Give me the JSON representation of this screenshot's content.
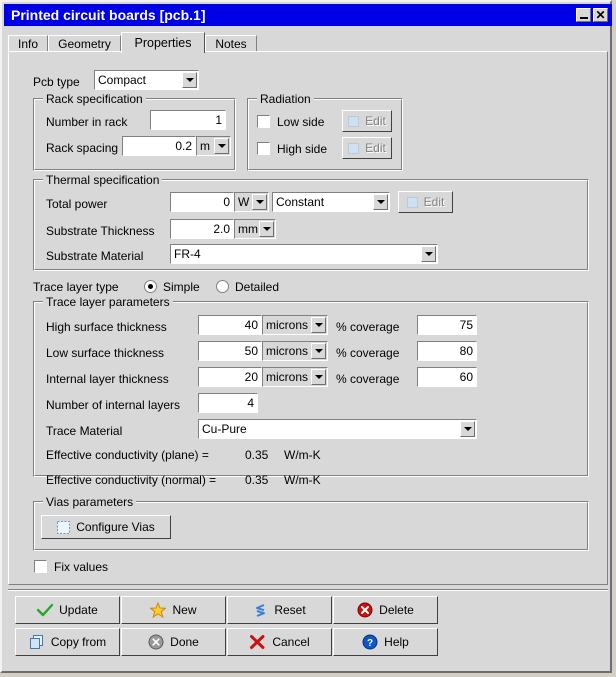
{
  "window": {
    "title": "Printed circuit boards [pcb.1]",
    "minimize_label": "minimize",
    "close_label": "close"
  },
  "tabs": [
    {
      "label": "Info",
      "active": false
    },
    {
      "label": "Geometry",
      "active": false
    },
    {
      "label": "Properties",
      "active": true
    },
    {
      "label": "Notes",
      "active": false
    }
  ],
  "properties": {
    "pcb_type": {
      "label": "Pcb type",
      "value": "Compact"
    },
    "rack": {
      "title": "Rack specification",
      "number_label": "Number in rack",
      "number_value": "1",
      "spacing_label": "Rack spacing",
      "spacing_value": "0.2",
      "spacing_unit": "m"
    },
    "radiation": {
      "title": "Radiation",
      "low_label": "Low side",
      "low_checked": false,
      "low_edit": "Edit",
      "high_label": "High side",
      "high_checked": false,
      "high_edit": "Edit"
    },
    "thermal": {
      "title": "Thermal specification",
      "power_label": "Total power",
      "power_value": "0",
      "power_unit": "W",
      "power_type": "Constant",
      "power_edit": "Edit",
      "thickness_label": "Substrate Thickness",
      "thickness_value": "2.0",
      "thickness_unit": "mm",
      "material_label": "Substrate Material",
      "material_value": "FR-4"
    },
    "trace_layer_type": {
      "label": "Trace layer type",
      "simple_label": "Simple",
      "detailed_label": "Detailed",
      "selected": "Simple"
    },
    "trace_params": {
      "title": "Trace layer parameters",
      "rows": [
        {
          "label": "High surface thickness",
          "value": "40",
          "unit": "microns",
          "coverage_label": "% coverage",
          "coverage_value": "75"
        },
        {
          "label": "Low surface thickness",
          "value": "50",
          "unit": "microns",
          "coverage_label": "% coverage",
          "coverage_value": "80"
        },
        {
          "label": "Internal layer thickness",
          "value": "20",
          "unit": "microns",
          "coverage_label": "% coverage",
          "coverage_value": "60"
        }
      ],
      "num_layers_label": "Number of internal layers",
      "num_layers_value": "4",
      "trace_material_label": "Trace Material",
      "trace_material_value": "Cu-Pure",
      "cond_plane_label": "Effective conductivity (plane) =",
      "cond_plane_value": "0.35",
      "cond_plane_unit": "W/m-K",
      "cond_normal_label": "Effective conductivity (normal) =",
      "cond_normal_value": "0.35",
      "cond_normal_unit": "W/m-K"
    },
    "vias": {
      "title": "Vias parameters",
      "configure_label": "Configure Vias"
    },
    "fix_values": {
      "label": "Fix values",
      "checked": false
    }
  },
  "buttons": [
    {
      "label": "Update",
      "icon": "check-icon"
    },
    {
      "label": "New",
      "icon": "star-icon"
    },
    {
      "label": "Reset",
      "icon": "refresh-icon"
    },
    {
      "label": "Delete",
      "icon": "delete-icon"
    },
    {
      "label": "Copy from",
      "icon": "copy-icon"
    },
    {
      "label": "Done",
      "icon": "done-icon"
    },
    {
      "label": "Cancel",
      "icon": "cancel-icon"
    },
    {
      "label": "Help",
      "icon": "help-icon"
    }
  ],
  "colors": {
    "titlebar": "#0000e6",
    "face": "#d8d8d8",
    "check_green": "#22aa22",
    "star_gold": "#ffcc33",
    "reset_blue": "#3a7fd5",
    "delete_red": "#cc1111",
    "cancel_red": "#cc1111",
    "help_blue": "#1155cc",
    "done_gray": "#808080"
  }
}
